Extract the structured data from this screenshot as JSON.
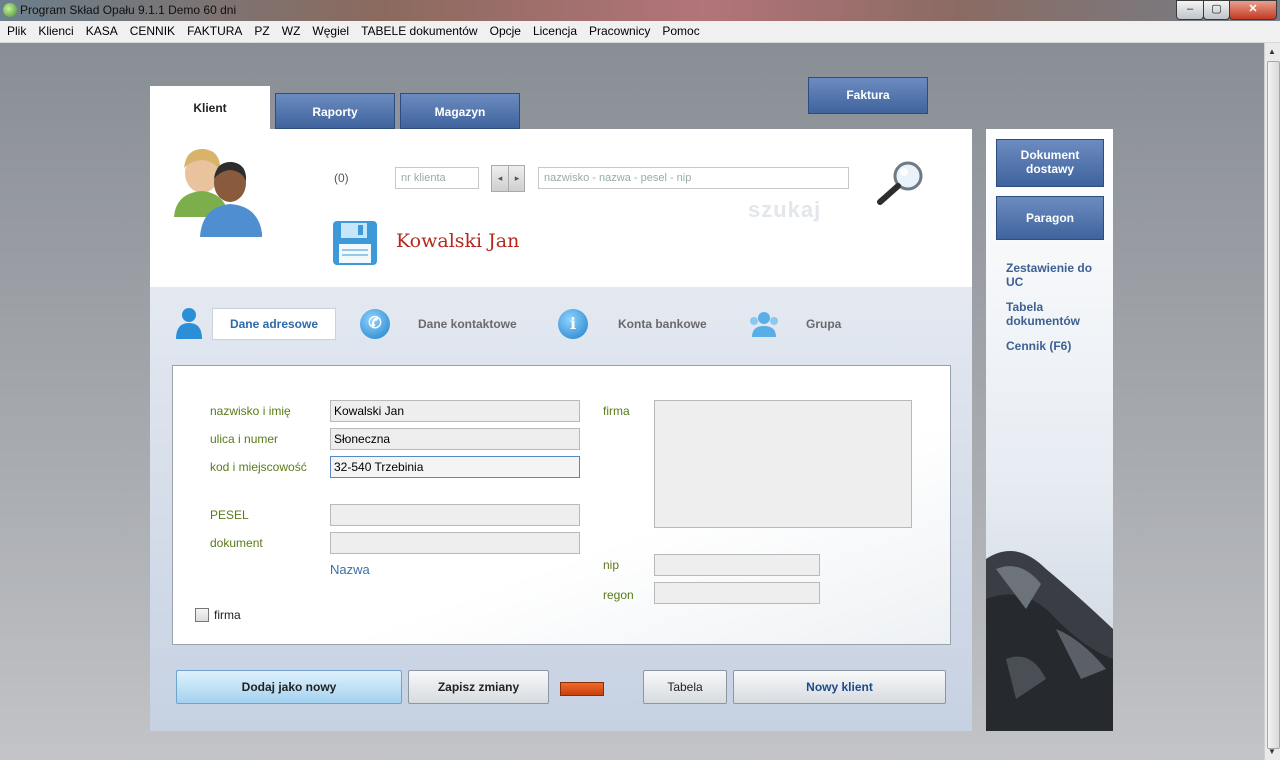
{
  "window": {
    "title": "Program Skład Opału 9.1.1    Demo 60 dni",
    "minimize": "‒",
    "maximize": "▢",
    "close": "✕"
  },
  "menu": [
    "Plik",
    "Klienci",
    "KASA",
    "CENNIK",
    "FAKTURA",
    "PZ",
    "WZ",
    "Węgiel",
    "TABELE dokumentów",
    "Opcje",
    "Licencja",
    "Pracownicy",
    "Pomoc"
  ],
  "tabs": {
    "klient": "Klient",
    "raporty": "Raporty",
    "magazyn": "Magazyn"
  },
  "faktura_button": "Faktura",
  "search": {
    "count": "(0)",
    "client_no_placeholder": "nr klienta",
    "prev": "◂",
    "next": "▸",
    "query_placeholder": "nazwisko - nazwa - pesel - nip",
    "watermark": "szukaj"
  },
  "client_name": "Kowalski Jan",
  "subtabs": {
    "address": "Dane adresowe",
    "contact": "Dane kontaktowe",
    "bank": "Konta bankowe",
    "group": "Grupa",
    "info_glyph": "i",
    "phone_glyph": "✆"
  },
  "form": {
    "name_label": "nazwisko i imię",
    "name_value": "Kowalski Jan",
    "street_label": "ulica i numer",
    "street_value": "Słoneczna",
    "city_label": "kod i miejscowość",
    "city_value": "32-540 Trzebinia",
    "pesel_label": "PESEL",
    "pesel_value": "",
    "document_label": "dokument",
    "document_value": "",
    "nazwa_link": "Nazwa",
    "firma_checkbox": "firma",
    "firma_label": "firma",
    "firma_value": "",
    "nip_label": "nip",
    "nip_value": "",
    "regon_label": "regon",
    "regon_value": ""
  },
  "buttons": {
    "add_new": "Dodaj jako nowy",
    "save_changes": "Zapisz zmiany",
    "table": "Tabela",
    "new_client": "Nowy klient"
  },
  "side": {
    "delivery_doc": "Dokument dostawy",
    "receipt": "Paragon",
    "links": [
      "Zestawienie do UC",
      "Tabela dokumentów",
      "Cennik (F6)"
    ]
  },
  "colors": {
    "accent_blue": "#3f639d",
    "client_name_red": "#b4291c",
    "label_green": "#5a7a1a",
    "link_blue": "#3d5f92"
  }
}
